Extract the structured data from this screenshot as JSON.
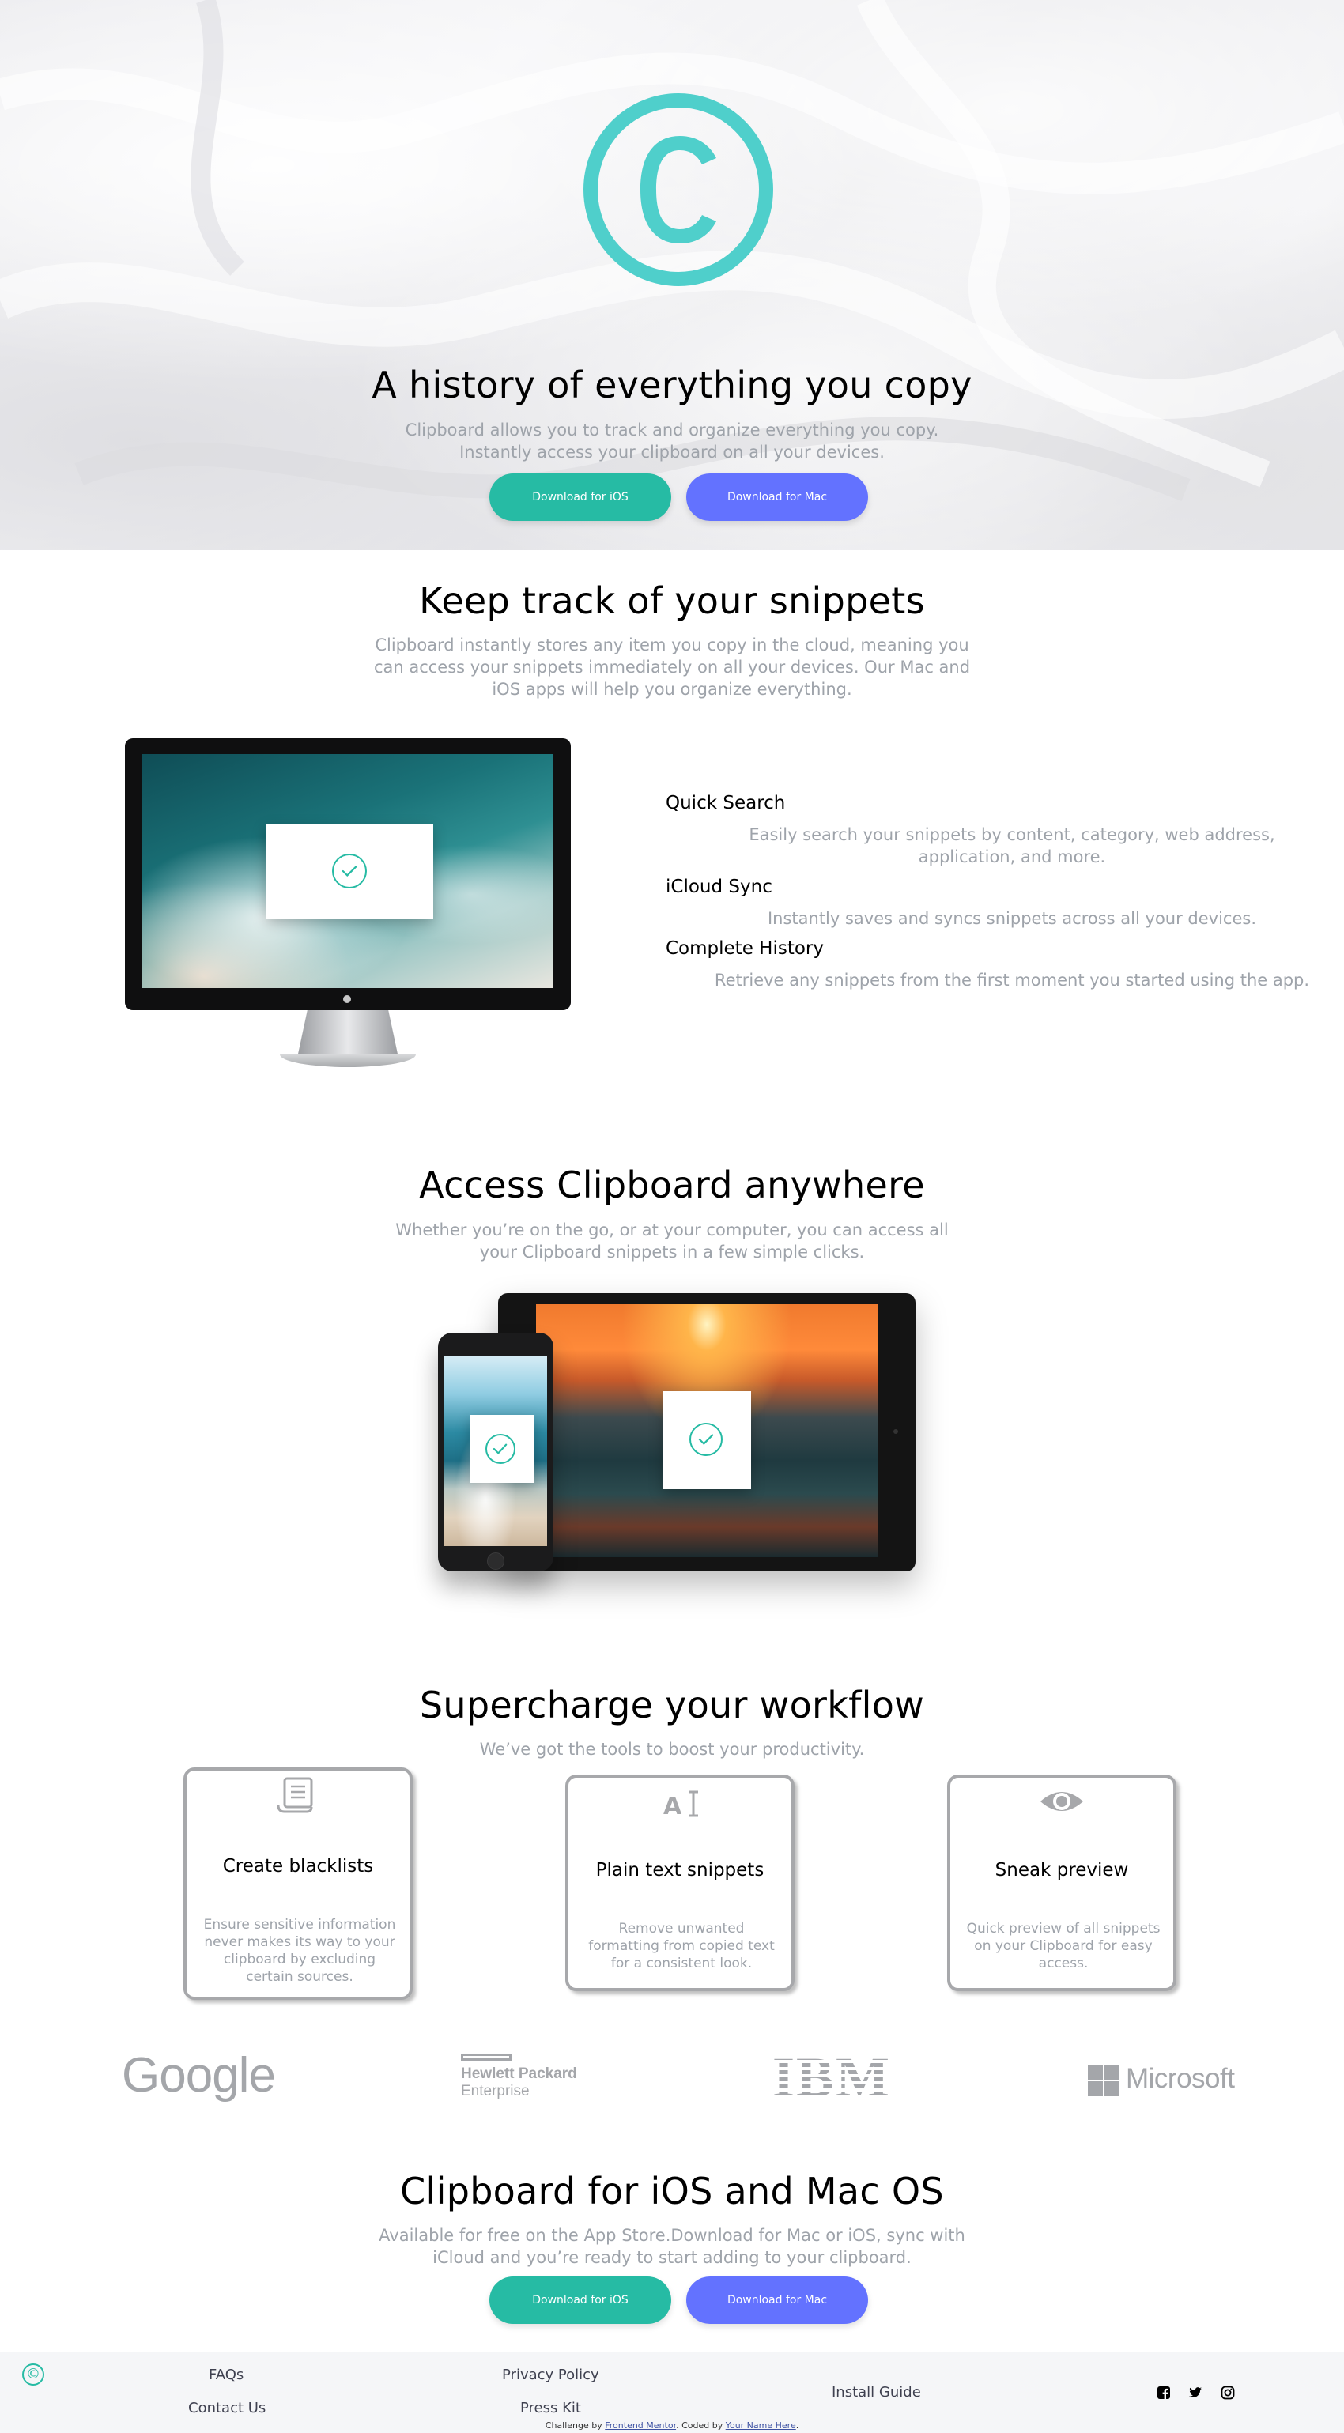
{
  "hero": {
    "title": "A history of everything you copy",
    "subtitle": "Clipboard allows you to track and organize everything you copy. Instantly access your clipboard on all your devices.",
    "btn_ios": "Download for iOS",
    "btn_mac": "Download for Mac"
  },
  "snippets": {
    "title": "Keep track of your snippets",
    "subtitle": "Clipboard instantly stores any item you copy in the cloud, meaning you can access your snippets immediately on all your devices. Our Mac and iOS apps will help you organize everything.",
    "features": [
      {
        "title": "Quick Search",
        "desc": "Easily search your snippets by content, category, web address, application, and more."
      },
      {
        "title": "iCloud Sync",
        "desc": "Instantly saves and syncs snippets across all your devices."
      },
      {
        "title": "Complete History",
        "desc": "Retrieve any snippets from the first moment you started using the app."
      }
    ]
  },
  "access": {
    "title": "Access Clipboard anywhere",
    "subtitle": "Whether you’re on the go, or at your computer, you can access all your Clipboard snippets in a few simple clicks."
  },
  "workflow": {
    "title": "Supercharge your workflow",
    "subtitle": "We’ve got the tools to boost your productivity.",
    "cards": [
      {
        "icon": "blacklist-icon",
        "title": "Create blacklists",
        "desc": "Ensure sensitive information never makes its way to your clipboard by excluding certain sources."
      },
      {
        "icon": "text-icon",
        "title": "Plain text snippets",
        "desc": "Remove unwanted formatting from copied text for a consistent look."
      },
      {
        "icon": "preview-icon",
        "title": "Sneak preview",
        "desc": "Quick preview of all snippets on your Clipboard for easy access."
      }
    ]
  },
  "partners": {
    "google": "Google",
    "hp_line1": "Hewlett Packard",
    "hp_line2": "Enterprise",
    "ibm": "IBM",
    "microsoft": "Microsoft"
  },
  "cta": {
    "title": "Clipboard for iOS and Mac OS",
    "subtitle": "Available for free on the App Store.Download for Mac or iOS, sync with iCloud and you’re ready to start adding to your clipboard.",
    "btn_ios": "Download for iOS",
    "btn_mac": "Download for Mac"
  },
  "footer": {
    "logo": "©",
    "links": {
      "faqs": "FAQs",
      "contact": "Contact Us",
      "privacy": "Privacy Policy",
      "press": "Press Kit",
      "install": "Install Guide"
    },
    "credit_prefix": "Challenge by",
    "credit_fm": "Frontend Mentor",
    "credit_mid": ". Coded by",
    "credit_name": "Your Name Here",
    "credit_end": "."
  },
  "colors": {
    "accent_green": "#26bba4",
    "accent_blue": "#6372ff",
    "logo_teal": "#4fcfcb",
    "text_gray": "#9ea3aa"
  }
}
